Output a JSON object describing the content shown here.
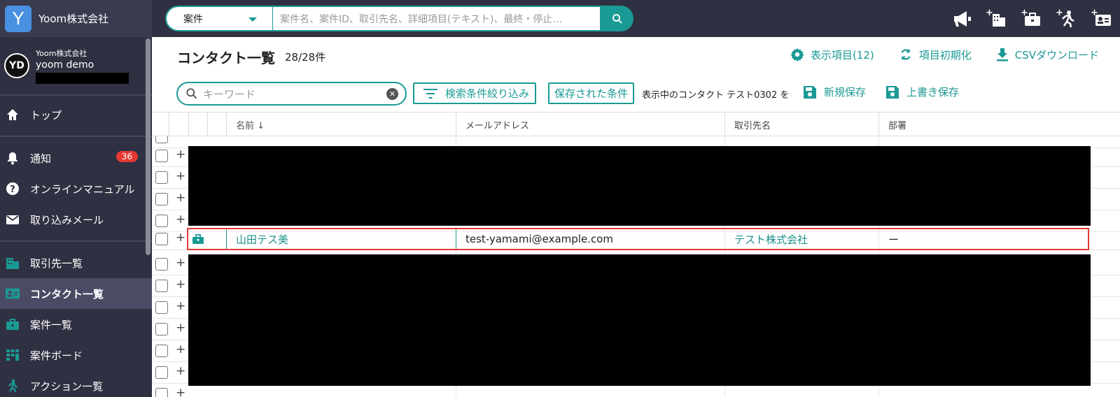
{
  "brand": {
    "logo_letter": "Y",
    "name": "Yoom株式会社"
  },
  "global_search": {
    "scope": "案件",
    "placeholder": "案件名、案件ID、取引先名、詳細項目(テキスト)、最終・停止…"
  },
  "top_icons": [
    "megaphone-icon",
    "add-company-icon",
    "add-deal-icon",
    "add-action-icon",
    "add-contact-icon"
  ],
  "user": {
    "company": "Yoom株式会社",
    "name": "yoom demo",
    "initials": "YD"
  },
  "sidebar": {
    "items": [
      {
        "label": "トップ",
        "icon": "home-icon"
      },
      {
        "label": "通知",
        "icon": "bell-icon",
        "badge": "36"
      },
      {
        "label": "オンラインマニュアル",
        "icon": "help-icon"
      },
      {
        "label": "取り込みメール",
        "icon": "mail-icon"
      },
      {
        "label": "取引先一覧",
        "icon": "company-icon"
      },
      {
        "label": "コンタクト一覧",
        "icon": "contact-card-icon",
        "active": true
      },
      {
        "label": "案件一覧",
        "icon": "briefcase-icon"
      },
      {
        "label": "案件ボード",
        "icon": "board-icon"
      },
      {
        "label": "アクション一覧",
        "icon": "walk-icon"
      }
    ]
  },
  "page": {
    "title": "コンタクト一覧",
    "count": "28/28件",
    "actions": {
      "columns": "表示項目(12)",
      "reset": "項目初期化",
      "csv": "CSVダウンロード"
    }
  },
  "toolbar": {
    "keyword_placeholder": "キーワード",
    "filter_label": "検索条件絞り込み",
    "saved_label": "保存された条件",
    "view_text": "表示中のコンタクト テスト0302 を",
    "save_new": "新規保存",
    "overwrite": "上書き保存"
  },
  "table": {
    "columns": {
      "name": "名前 ↓",
      "email": "メールアドレス",
      "company": "取引先名",
      "dept": "部署"
    },
    "highlighted_row": {
      "name": "山田テス美",
      "email": "test-yamami@example.com",
      "company": "テスト株式会社",
      "dept": "ー"
    }
  },
  "colors": {
    "accent": "#1a9a95",
    "sidebar": "#2f3041",
    "highlight": "#e53935"
  }
}
